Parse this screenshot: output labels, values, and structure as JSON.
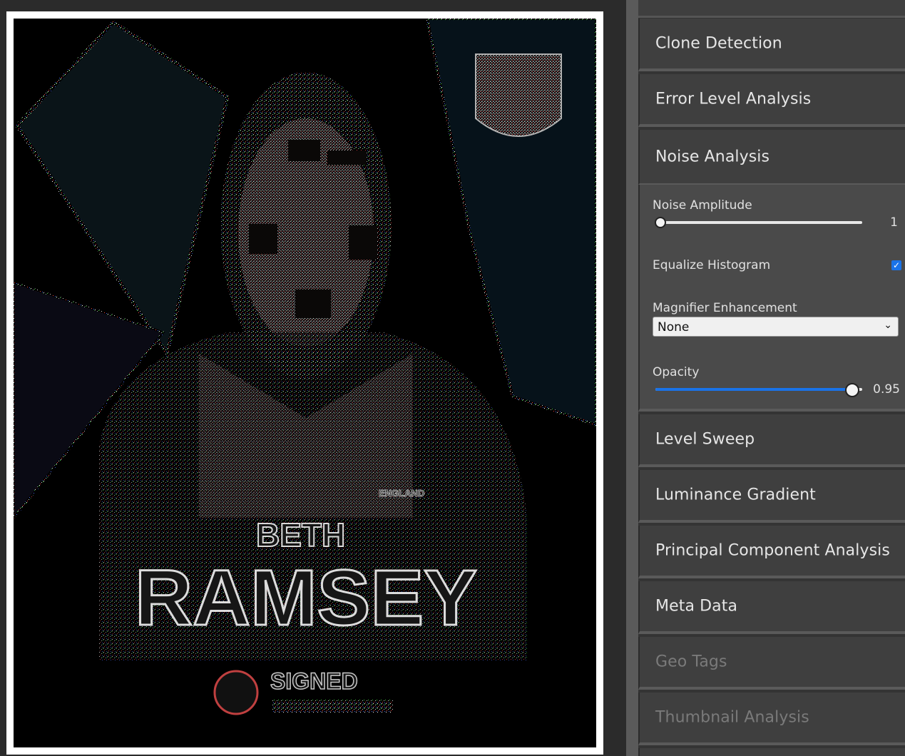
{
  "canvas": {
    "poster_text_top": "BETH",
    "poster_text_main": "RAMSEY",
    "poster_text_badge": "SIGNED",
    "poster_text_crest": "ENGLAND"
  },
  "panel": {
    "sections": [
      {
        "label": "Clone Detection",
        "enabled": true
      },
      {
        "label": "Error Level Analysis",
        "enabled": true
      },
      {
        "label": "Noise Analysis",
        "enabled": true,
        "expanded": true
      },
      {
        "label": "Level Sweep",
        "enabled": true
      },
      {
        "label": "Luminance Gradient",
        "enabled": true
      },
      {
        "label": "Principal Component Analysis",
        "enabled": true
      },
      {
        "label": "Meta Data",
        "enabled": true
      },
      {
        "label": "Geo Tags",
        "enabled": false
      },
      {
        "label": "Thumbnail Analysis",
        "enabled": false
      }
    ],
    "noise": {
      "amplitude_label": "Noise Amplitude",
      "amplitude_value": "1",
      "equalize_label": "Equalize Histogram",
      "equalize_checked": true,
      "magnifier_label": "Magnifier Enhancement",
      "magnifier_value": "None",
      "opacity_label": "Opacity",
      "opacity_value": "0.95"
    }
  },
  "colors": {
    "accent": "#1a73e8",
    "panel_bg": "#3f3f3f",
    "panel_open_bg": "#4a4a4a"
  }
}
